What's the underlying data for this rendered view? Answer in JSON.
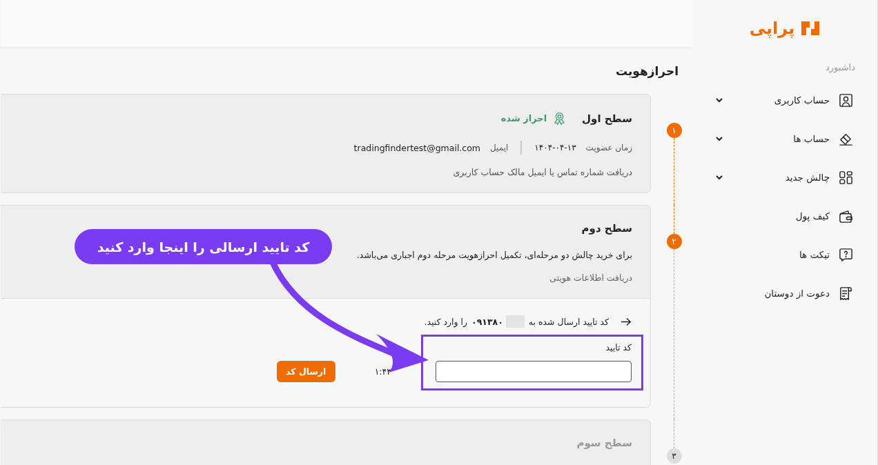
{
  "sidebar": {
    "logo_text": "پراپی",
    "section_label": "داشبورد",
    "items": [
      {
        "label": "حساب کاربری",
        "expandable": true
      },
      {
        "label": "حساب ها",
        "expandable": true
      },
      {
        "label": "چالش جدید",
        "expandable": true
      },
      {
        "label": "کیف پول",
        "expandable": false
      },
      {
        "label": "تیکت ها",
        "expandable": false
      },
      {
        "label": "دعوت از دوستان",
        "expandable": false
      }
    ]
  },
  "page_title": "احرازهویت",
  "levels": [
    {
      "number": "۱",
      "kind": "done",
      "title": "سطح اول",
      "badge": "احراز شده",
      "meta": [
        {
          "label": "زمان عضویت",
          "value": "۱۴۰۴-۰۴-۱۳",
          "kind": "date"
        },
        {
          "label": "ایمیل",
          "value": "tradingfindertest@gmail.com",
          "kind": "email"
        }
      ],
      "note": "دریافت شماره تماس یا ایمیل مالک حساب کاربری"
    },
    {
      "number": "۲",
      "kind": "active",
      "title": "سطح دوم",
      "description": "برای خرید چالش دو مرحله‌ای، تکمیل احرازهویت مرحله دوم اجباری می‌باشد.",
      "note": "دریافت اطلاعات هویتی",
      "verification": {
        "prompt_before": "کد تایید ارسال شده به",
        "phone_masked": true,
        "phone_visible": "۰۹۱۳۸۰",
        "prompt_after": "را وارد کنید.",
        "field_label": "کد تایید",
        "timer": "۱:۴۳",
        "button": "ارسال کد"
      }
    },
    {
      "number": "۳",
      "kind": "pending",
      "title": "سطح سوم"
    }
  ],
  "annotation": {
    "callout": "کد تایید ارسالی را اینجا وارد کنید",
    "highlight_field": true
  }
}
